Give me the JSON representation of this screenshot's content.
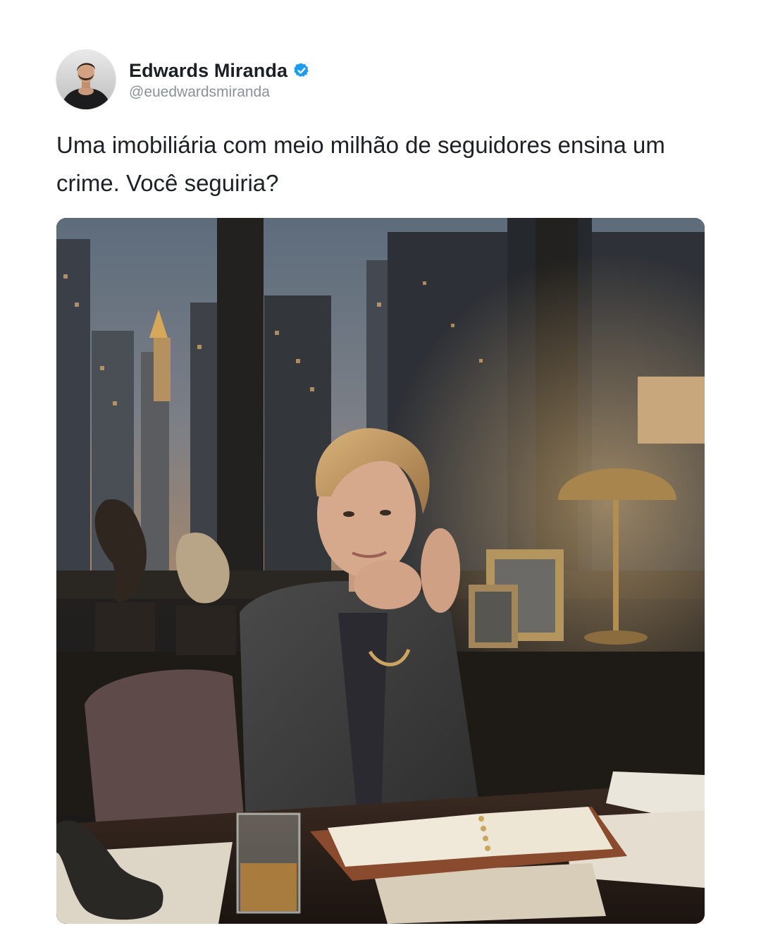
{
  "author": {
    "display_name": "Edwards Miranda",
    "handle": "@euedwardsmiranda",
    "verified": true,
    "avatar_icon": "person-avatar"
  },
  "post": {
    "text": "Uma imobiliária com meio milhão de seguidores ensina um crime. Você seguiria?"
  },
  "media": {
    "type": "photo"
  },
  "colors": {
    "verified_badge": "#1d9bf0",
    "name_text": "#1b1f23",
    "handle_text": "#8a9197",
    "body_text": "#1d2126"
  }
}
